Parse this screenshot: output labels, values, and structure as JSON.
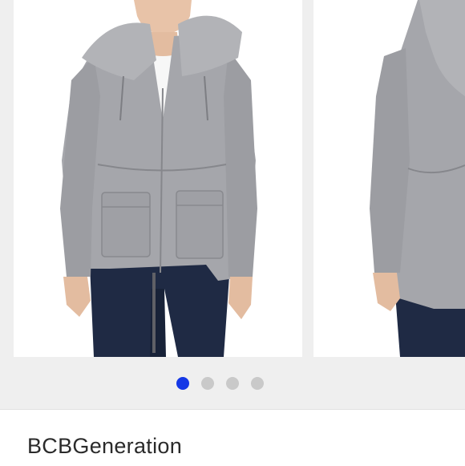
{
  "product": {
    "brand": "BCBGeneration"
  },
  "carousel": {
    "slide_count": 4,
    "active_index": 0,
    "images": [
      {
        "icon": "jacket-front-photo"
      },
      {
        "icon": "jacket-back-photo"
      }
    ]
  },
  "colors": {
    "active_dot": "#1538e6",
    "inactive_dot": "#c9c9c9",
    "jacket": "#a5a6ab",
    "background": "#efefef"
  }
}
